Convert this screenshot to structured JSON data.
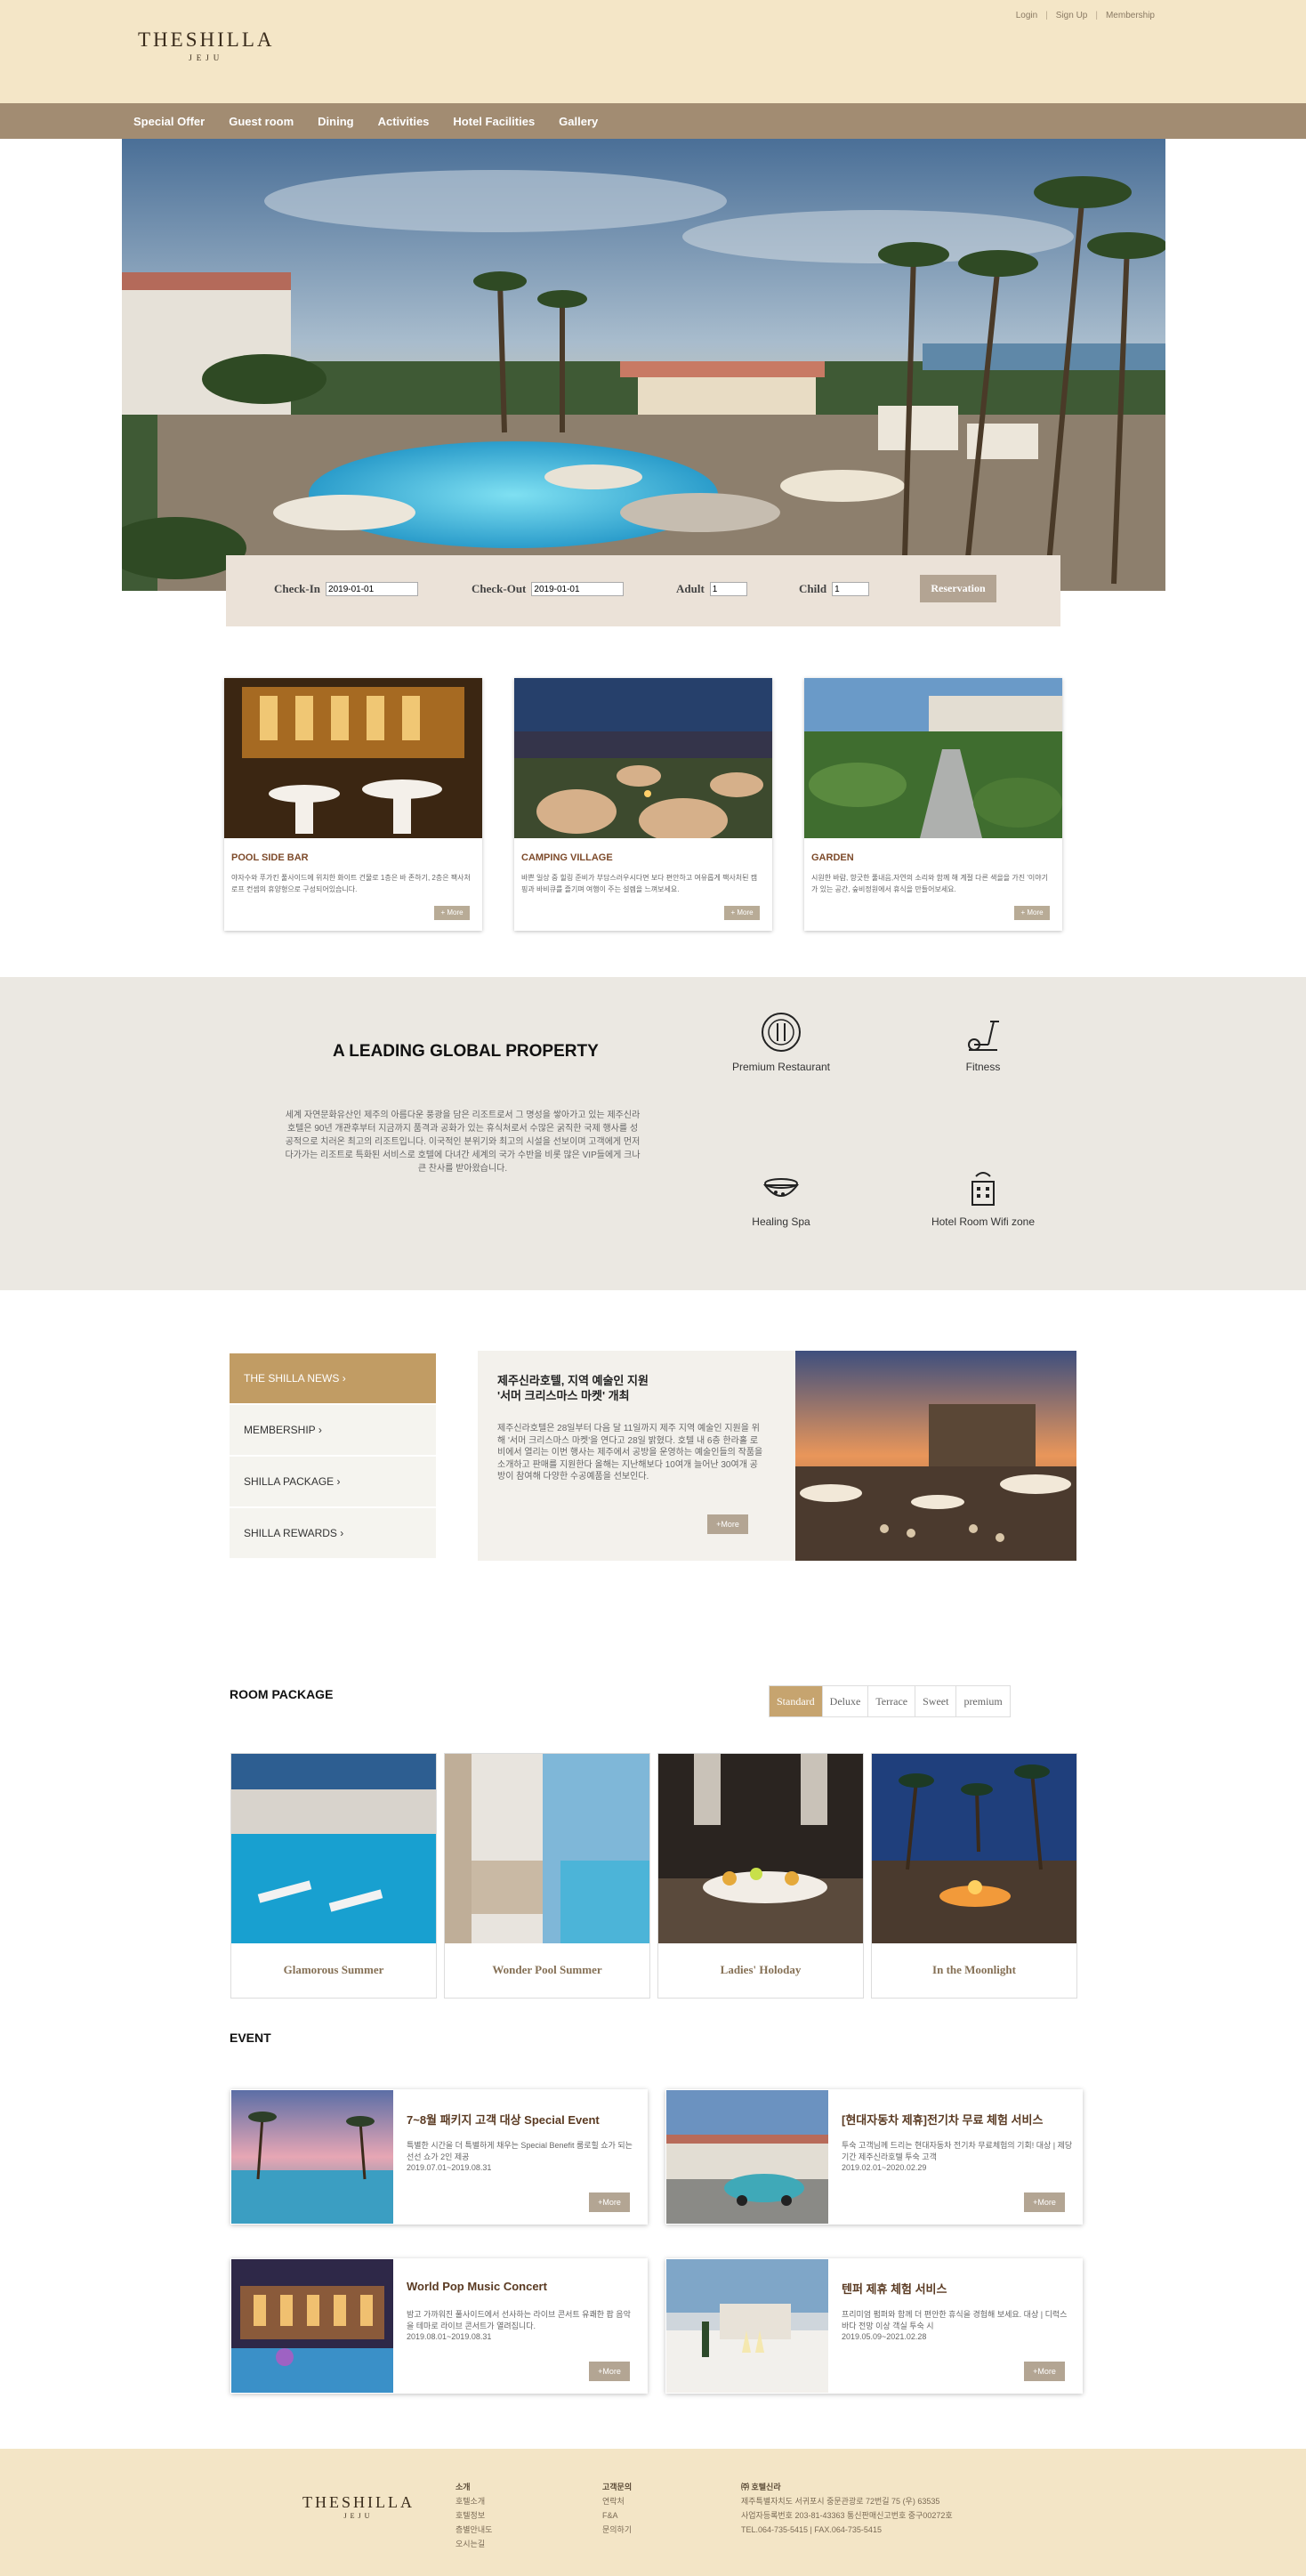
{
  "header": {
    "logo_main": "THESHILLA",
    "logo_sub": "JEJU",
    "links": [
      "Login",
      "Sign Up",
      "Membership"
    ],
    "link_separator": "|"
  },
  "nav": [
    "Special Offer",
    "Guest room",
    "Dining",
    "Activities",
    "Hotel Facilities",
    "Gallery"
  ],
  "booking": {
    "checkin_label": "Check-In",
    "checkin_value": "2019-01-01",
    "checkout_label": "Check-Out",
    "checkout_value": "2019-01-01",
    "adult_label": "Adult",
    "adult_value": "1",
    "child_label": "Child",
    "child_value": "1",
    "button": "Reservation"
  },
  "cards": [
    {
      "title": "POOL SIDE BAR",
      "desc": "야자수와 푸가킨 풀사이드에 위치한 화이트 건물로 1층은 바 존하기, 2층은 팩사처 로프 컨셉의 휴양형으로 구성되어있습니다.",
      "more": "+ More"
    },
    {
      "title": "CAMPING VILLAGE",
      "desc": "바쁜 일상 중 힐링 준비가 부담스러우시다면 보다 편안하고 여유롭게 팩사처된 캠핑과 바비큐를 즐기며 여행이 주는 설렘을 느껴보세요.",
      "more": "+ More"
    },
    {
      "title": "GARDEN",
      "desc": "시원한 바람, 향긋한 풀내음,자연의 소리와 함께 해 계절 다른 색을을 가진 '이야기가 있는 공간, 숲비정원에서 휴식을 만들어보세요.",
      "more": "+ More"
    }
  ],
  "leading": {
    "title": "A LEADING GLOBAL PROPERTY",
    "text": "세계 자연문화유산인 제주의 아름다운 풍광을 담은 리조트로서 그 명성을 쌓아가고 있는 제주신라호텔은 90년 개관후부터 지금까지 품격과 공화가 있는 휴식처로서 수많은 굵직한 국제 행사를 성공적으로 치러온 최고의 리조트입니다. 이국적인 분위기와 최고의 시설을 선보이며 고객에게 먼저 다가가는 리조트로 특화된 서비스로 호텔에 다녀간 세계의 국가 수반을 비롯 많은 VIP들에게 크나큰 찬사를 받아왔습니다.",
    "features": [
      "Premium Restaurant",
      "Fitness",
      "Healing Spa",
      "Hotel Room Wifi zone"
    ]
  },
  "news": {
    "menu": [
      "THE SHILLA NEWS",
      "MEMBERSHIP",
      "SHILLA PACKAGE",
      "SHILLA REWARDS"
    ],
    "arrow": "›",
    "title_line1": "제주신라호텔, 지역 예술인 지원",
    "title_line2": "'서머 크리스마스 마켓' 개최",
    "body": "제주신라호텔은 28일부터 다음 달 11일까지 제주 지역 예술인 지원을 위해 '서머 크리스마스 마켓'을 연다고 28일 밝혔다. 호텔 내 6층 한라홀 로비에서 열리는 이번 행사는 제주에서 공방을 운영하는 예술인들의 작품을 소개하고 판매를 지원한다 올해는 지난해보다 10여개 늘어난 30여개 공방이 참여해 다양한 수공예품을 선보인다.",
    "more": "+More"
  },
  "rooms": {
    "title": "ROOM PACKAGE",
    "tabs": [
      "Standard",
      "Deluxe",
      "Terrace",
      "Sweet",
      "premium"
    ],
    "items": [
      "Glamorous Summer",
      "Wonder Pool Summer",
      "Ladies' Holoday",
      "In the Moonlight"
    ]
  },
  "events": {
    "title": "EVENT",
    "items": [
      {
        "title": "7~8월 패키지 고객 대상 Special Event",
        "desc": "특별한 시간을 더 특별하게 채우는 Special Benefit 룸로힐 쇼가 되는 선선 쇼가 2인 제공",
        "date": "2019.07.01~2019.08.31",
        "more": "+More"
      },
      {
        "title": "[현대자동차 제휴]전기차 무료 체험 서비스",
        "desc": "투숙 고객님께 드리는 현대자동차 전기차 무료체험의 기회! 대상 | 제당 기간 제주신라호텔 투숙 고객",
        "date": "2019.02.01~2020.02.29",
        "more": "+More"
      },
      {
        "title": "World Pop Music Concert",
        "desc": "밤고 가까워진 풀사이드에서 선사하는 라이브 콘서트 유쾌한 팝 음악을 테마로 라이브 콘서트가 열려집니다.",
        "date": "2019.08.01~2019.08.31",
        "more": "+More"
      },
      {
        "title": "텐퍼 제휴 체험 서비스",
        "desc": "프리미엄 펌퍼와 함께 더 편안한 휴식을 경험해 보세요. 대상 | 디럭스 바다 전망 이상 객실 투숙 시",
        "date": "2019.05.09~2021.02.28",
        "more": "+More"
      }
    ]
  },
  "footer": {
    "logo_main": "THESHILLA",
    "logo_sub": "JEJU",
    "col1_head": "소개",
    "col1": [
      "호텔소개",
      "호텔정보",
      "층별안내도",
      "오시는길"
    ],
    "col2_head": "고객문의",
    "col2": [
      "연락처",
      "F&A",
      "문의하기"
    ],
    "col3_head": "㈜ 호텔신라",
    "col3": [
      "제주특별자치도 서귀포시 중문관광로 72번길 75 (우) 63535",
      "사업자등록번호 203-81-43363 통신판매신고번호 중구00272호",
      "TEL.064-735-5415 | FAX.064-735-5415"
    ]
  },
  "colors": {
    "header_bg": "#f4e6c7",
    "nav_bg": "#a28c72",
    "accent": "#c19c64"
  }
}
